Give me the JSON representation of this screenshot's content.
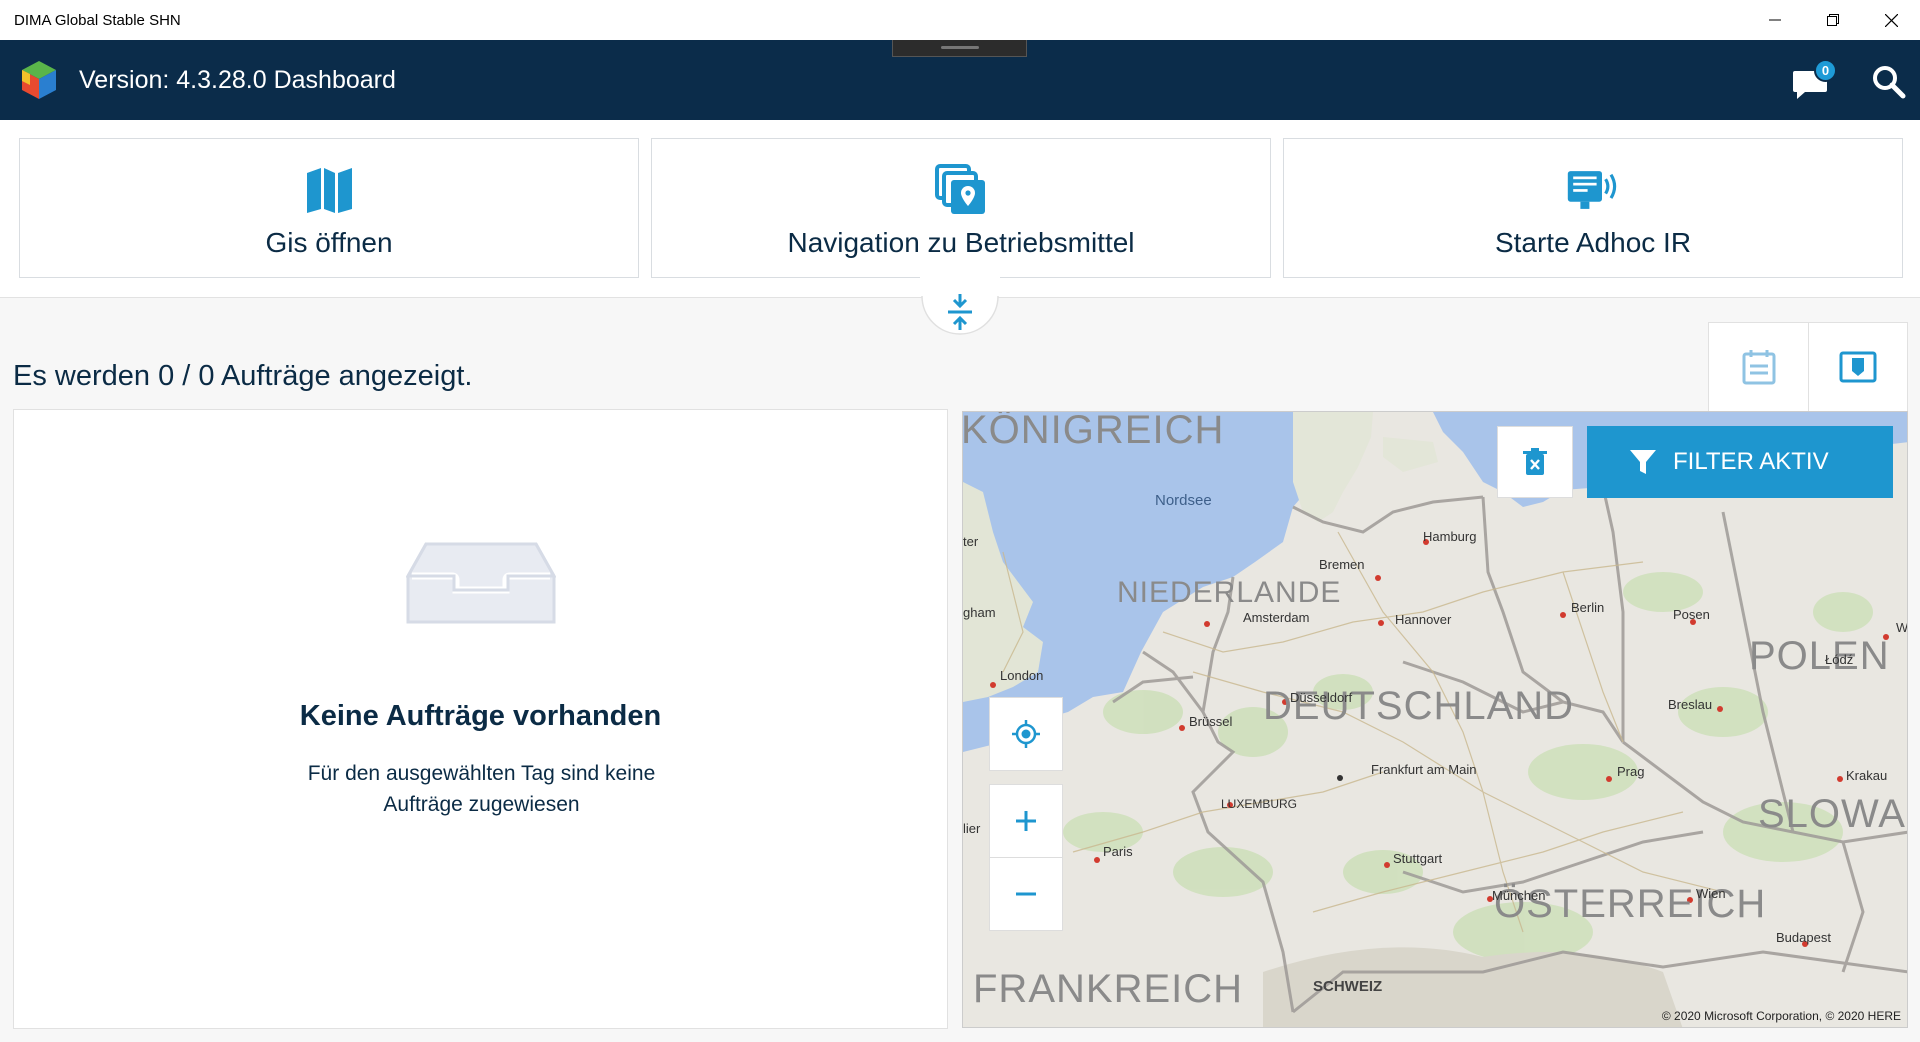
{
  "window": {
    "title": "DIMA Global Stable SHN"
  },
  "header": {
    "version_title": "Version: 4.3.28.0 Dashboard",
    "message_count": "0"
  },
  "actions": [
    {
      "label": "Gis öffnen",
      "icon": "map-icon"
    },
    {
      "label": "Navigation zu Betriebsmittel",
      "icon": "navigate-asset-icon"
    },
    {
      "label": "Starte Adhoc IR",
      "icon": "adhoc-ir-device-icon"
    }
  ],
  "orders": {
    "summary": "Es werden 0 / 0 Aufträge angezeigt.",
    "empty_title": "Keine Aufträge vorhanden",
    "empty_message": "Für den ausgewählten Tag sind keine Aufträge zugewiesen"
  },
  "map": {
    "filter_label": "FILTER AKTIV",
    "copyright": "© 2020 Microsoft Corporation, © 2020 HERE",
    "countries": [
      "KÖNIGREICH",
      "NIEDERLANDE",
      "DEUTSCHLAND",
      "POLEN",
      "SLOWAK",
      "ÖSTERREICH",
      "FRANKREICH",
      "SCHWEIZ"
    ],
    "sea": "Nordsee",
    "cities": [
      "Hamburg",
      "Bremen",
      "Hannover",
      "Berlin",
      "Posen",
      "Amsterdam",
      "London",
      "Düsseldorf",
      "Brüssel",
      "Breslau",
      "Łódź",
      "Frankfurt am Main",
      "Prag",
      "Krakau",
      "LUXEMBURG",
      "Paris",
      "Stuttgart",
      "Wien",
      "München",
      "Budapest"
    ],
    "edge_fragments": [
      "ter",
      "gham",
      "lier",
      "W"
    ]
  },
  "colors": {
    "header_bg": "#0b2c4a",
    "accent": "#1e96cf",
    "text_primary": "#0b2b45"
  }
}
